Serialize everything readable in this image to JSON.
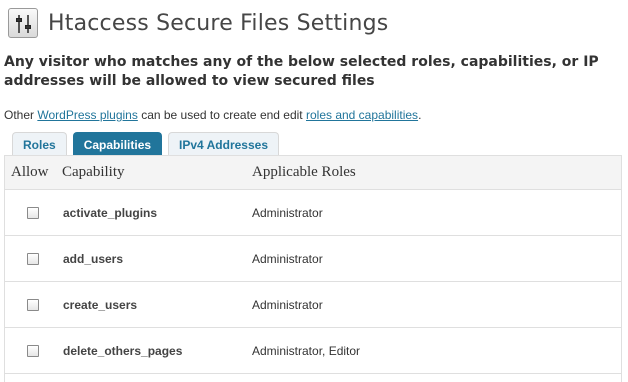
{
  "header": {
    "title": "Htaccess Secure Files Settings",
    "icon": "settings-sliders-icon"
  },
  "intro": {
    "text": "Any visitor who matches any of the below selected roles, capabilities, or IP addresses will be allowed to view secured files"
  },
  "note": {
    "prefix": "Other ",
    "link1": "WordPress plugins",
    "middle": " can be used to create end edit ",
    "link2": "roles and capabilities",
    "suffix": "."
  },
  "tabs": [
    {
      "label": "Roles",
      "active": false
    },
    {
      "label": "Capabilities",
      "active": true
    },
    {
      "label": "IPv4 Addresses",
      "active": false
    }
  ],
  "table": {
    "headers": {
      "allow": "Allow",
      "capability": "Capability",
      "roles": "Applicable Roles"
    },
    "rows": [
      {
        "capability": "activate_plugins",
        "roles": "Administrator",
        "checked": false
      },
      {
        "capability": "add_users",
        "roles": "Administrator",
        "checked": false
      },
      {
        "capability": "create_users",
        "roles": "Administrator",
        "checked": false
      },
      {
        "capability": "delete_others_pages",
        "roles": "Administrator, Editor",
        "checked": false
      }
    ]
  },
  "colors": {
    "accent": "#21759b",
    "text": "#333333",
    "border": "#dfdfdf"
  }
}
